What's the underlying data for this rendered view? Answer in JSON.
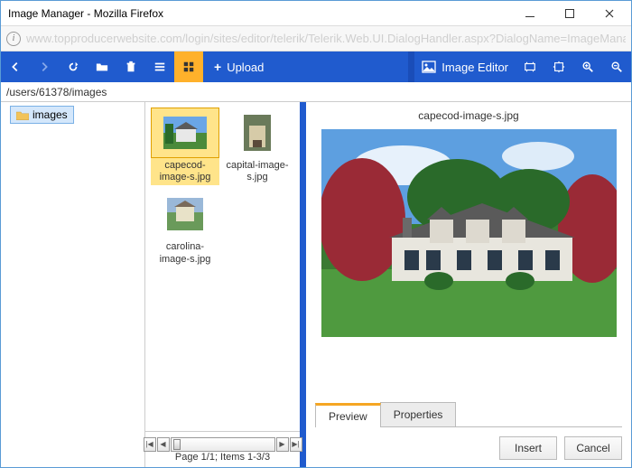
{
  "window": {
    "title": "Image Manager - Mozilla Firefox",
    "url": "www.topproducerwebsite.com/login/sites/editor/telerik/Telerik.Web.UI.DialogHandler.aspx?DialogName=ImageManager&UseR"
  },
  "toolbar": {
    "upload_label": "Upload",
    "editor_label": "Image Editor"
  },
  "path": "/users/61378/images",
  "tree": {
    "root_label": "images"
  },
  "files": [
    {
      "name": "capecod-image-s.jpg",
      "selected": true
    },
    {
      "name": "capital-image-s.jpg",
      "selected": false
    },
    {
      "name": "carolina-image-s.jpg",
      "selected": false
    }
  ],
  "pager": {
    "status": "Page 1/1; Items 1-3/3"
  },
  "preview": {
    "filename": "capecod-image-s.jpg"
  },
  "tabs": {
    "preview": "Preview",
    "properties": "Properties"
  },
  "buttons": {
    "insert": "Insert",
    "cancel": "Cancel"
  }
}
